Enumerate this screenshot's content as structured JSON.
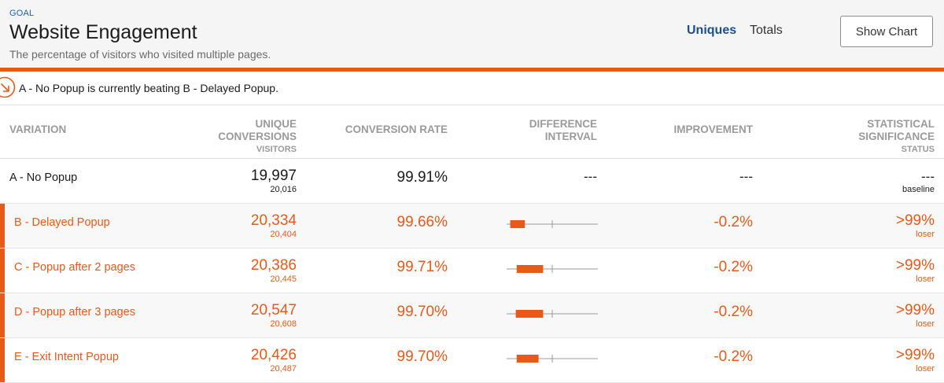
{
  "colors": {
    "accent": "#e8591a",
    "link": "#1a4f95",
    "muted": "#9a9a9a"
  },
  "header": {
    "goal_label": "GOAL",
    "title": "Website Engagement",
    "description": "The percentage of visitors who visited multiple pages.",
    "tabs": {
      "uniques": "Uniques",
      "totals": "Totals",
      "selected": "Uniques"
    },
    "show_chart_label": "Show Chart"
  },
  "alert": {
    "icon": "arrow-down-right-circle-icon",
    "text": "A - No Popup is currently beating B - Delayed Popup."
  },
  "table": {
    "headers": {
      "variation": "VARIATION",
      "conversions": "UNIQUE CONVERSIONS",
      "conversions_sub": "VISITORS",
      "rate": "CONVERSION RATE",
      "interval": "DIFFERENCE INTERVAL",
      "improvement": "IMPROVEMENT",
      "significance": "STATISTICAL SIGNIFICANCE",
      "significance_sub": "STATUS"
    },
    "baseline": {
      "name": "A - No Popup",
      "conversions": "19,997",
      "visitors": "20,016",
      "rate": "99.91%",
      "interval": "---",
      "improvement": "---",
      "significance": "---",
      "status": "baseline"
    },
    "rows": [
      {
        "name": "B - Delayed Popup",
        "conversions": "20,334",
        "visitors": "20,404",
        "rate": "99.66%",
        "improvement": "-0.2%",
        "significance": ">99%",
        "status": "loser",
        "interval_fraction": [
          0.04,
          0.2
        ]
      },
      {
        "name": "C - Popup after 2 pages",
        "conversions": "20,386",
        "visitors": "20,445",
        "rate": "99.71%",
        "improvement": "-0.2%",
        "significance": ">99%",
        "status": "loser",
        "interval_fraction": [
          0.11,
          0.4
        ]
      },
      {
        "name": "D - Popup after 3 pages",
        "conversions": "20,547",
        "visitors": "20,608",
        "rate": "99.70%",
        "improvement": "-0.2%",
        "significance": ">99%",
        "status": "loser",
        "interval_fraction": [
          0.1,
          0.4
        ]
      },
      {
        "name": "E - Exit Intent Popup",
        "conversions": "20,426",
        "visitors": "20,487",
        "rate": "99.70%",
        "improvement": "-0.2%",
        "significance": ">99%",
        "status": "loser",
        "interval_fraction": [
          0.11,
          0.35
        ]
      }
    ]
  }
}
